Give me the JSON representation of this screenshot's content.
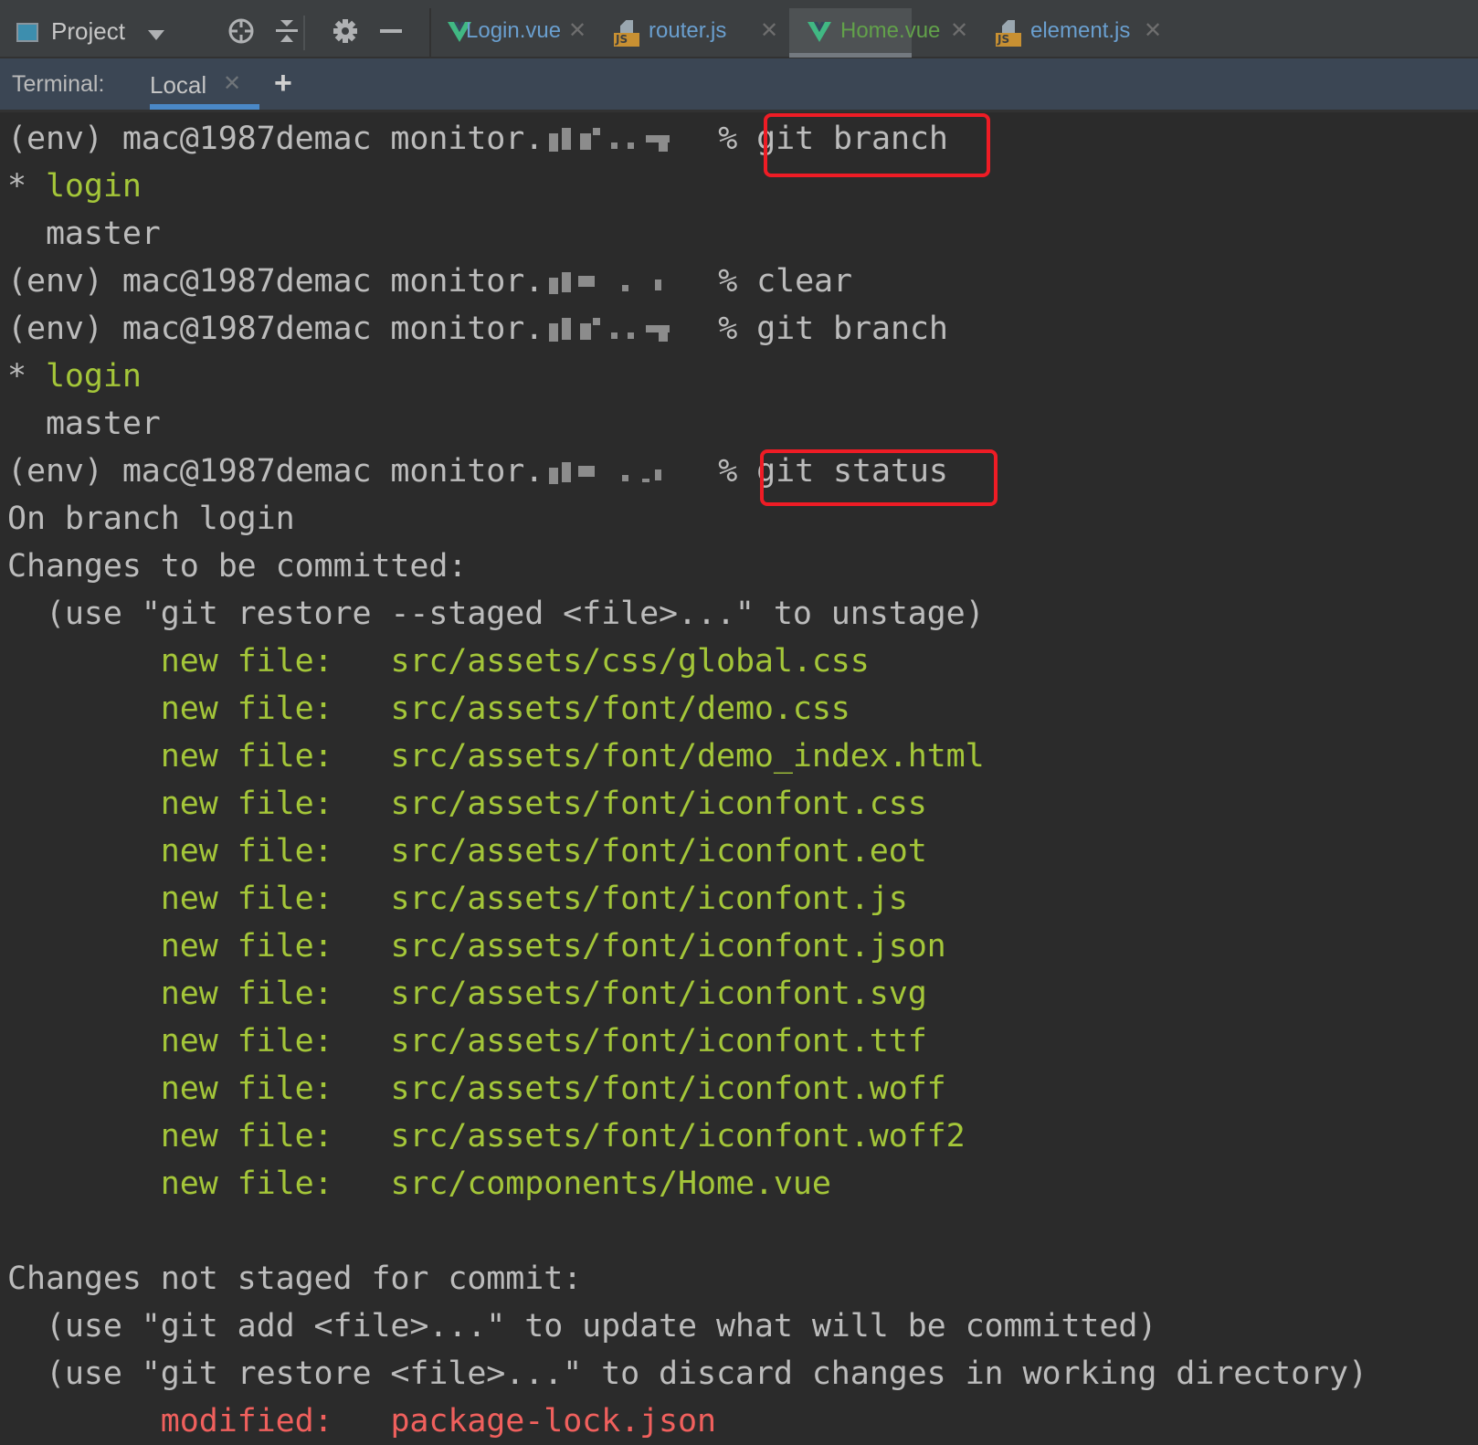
{
  "toolbar": {
    "project_label": "Project",
    "icons": [
      "locate-icon",
      "collapse-icon",
      "gear-icon",
      "minimize-icon"
    ]
  },
  "editor_tabs": [
    {
      "label": "Login.vue",
      "icon": "vue-icon",
      "active": false,
      "color": "#6a9fcf"
    },
    {
      "label": "router.js",
      "icon": "js-icon",
      "active": false,
      "color": "#6a9fcf"
    },
    {
      "label": "Home.vue",
      "icon": "vue-icon",
      "active": true,
      "color": "#62a14a"
    },
    {
      "label": "element.js",
      "icon": "js-icon",
      "active": false,
      "color": "#6a9fcf"
    }
  ],
  "terminal_bar": {
    "label": "Terminal:",
    "tab_label": "Local",
    "add_label": "+"
  },
  "terminal": {
    "prompt": "(env) mac@1987demac monitor.",
    "prompt_suffix": " % ",
    "lines": {
      "cmd1": "git branch",
      "branch_current_mark": "* ",
      "branch_current": "login",
      "branch_other": "  master",
      "cmd2": "clear",
      "cmd3": "git branch",
      "cmd4": "git status",
      "on_branch": "On branch login",
      "staged_header": "Changes to be committed:",
      "staged_hint": "  (use \"git restore --staged <file>...\" to unstage)",
      "staged_files": [
        {
          "status": "new file:",
          "path": "src/assets/css/global.css"
        },
        {
          "status": "new file:",
          "path": "src/assets/font/demo.css"
        },
        {
          "status": "new file:",
          "path": "src/assets/font/demo_index.html"
        },
        {
          "status": "new file:",
          "path": "src/assets/font/iconfont.css"
        },
        {
          "status": "new file:",
          "path": "src/assets/font/iconfont.eot"
        },
        {
          "status": "new file:",
          "path": "src/assets/font/iconfont.js"
        },
        {
          "status": "new file:",
          "path": "src/assets/font/iconfont.json"
        },
        {
          "status": "new file:",
          "path": "src/assets/font/iconfont.svg"
        },
        {
          "status": "new file:",
          "path": "src/assets/font/iconfont.ttf"
        },
        {
          "status": "new file:",
          "path": "src/assets/font/iconfont.woff"
        },
        {
          "status": "new file:",
          "path": "src/assets/font/iconfont.woff2"
        },
        {
          "status": "new file:",
          "path": "src/components/Home.vue"
        }
      ],
      "unstaged_header": "Changes not staged for commit:",
      "unstaged_hint1": "  (use \"git add <file>...\" to update what will be committed)",
      "unstaged_hint2": "  (use \"git restore <file>...\" to discard changes in working directory)",
      "modified_files": [
        {
          "status": "modified:",
          "path": "package-lock.json"
        }
      ]
    }
  },
  "colors": {
    "background": "#2b2b2b",
    "staged_green": "#a4c639",
    "modified_red": "#f0605d",
    "highlight_red": "#ee1c25",
    "terminal_tab_underline": "#4a88c7"
  }
}
